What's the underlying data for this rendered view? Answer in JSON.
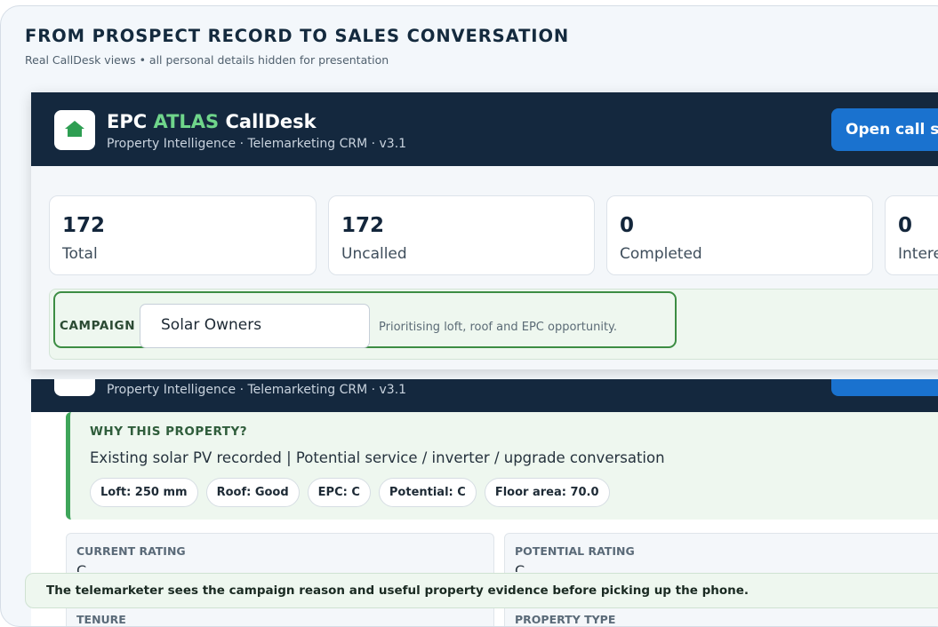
{
  "page": {
    "title": "FROM PROSPECT RECORD TO SALES CONVERSATION",
    "subtitle": "Real CallDesk views • all personal details hidden for presentation",
    "caption": "The telemarketer sees the campaign reason and useful property evidence before picking up the phone."
  },
  "app": {
    "title_prefix": "EPC ",
    "title_accent": "ATLAS",
    "title_suffix": " CallDesk",
    "tagline": "Property Intelligence · Telemarketing CRM · v3.1",
    "open_button": "Open call sh",
    "logo_icon": "house-icon",
    "colors": {
      "header": "#14283e",
      "accent": "#6fd58b",
      "button": "#1a72cf",
      "campaign_ring": "#3c8d43"
    }
  },
  "stats": [
    {
      "value": "172",
      "label": "Total"
    },
    {
      "value": "172",
      "label": "Uncalled"
    },
    {
      "value": "0",
      "label": "Completed"
    },
    {
      "value": "0",
      "label": "Intere"
    }
  ],
  "campaign": {
    "label": "CAMPAIGN",
    "selected": "Solar Owners",
    "note": "Prioritising loft, roof and EPC opportunity."
  },
  "why": {
    "heading": "WHY THIS PROPERTY?",
    "text": "Existing solar PV recorded | Potential service / inverter / upgrade conversation",
    "chips": [
      "Loft: 250 mm",
      "Roof: Good",
      "EPC: C",
      "Potential: C",
      "Floor area: 70.0"
    ]
  },
  "ratings": {
    "current_label": "CURRENT RATING",
    "current_value": "C",
    "potential_label": "POTENTIAL RATING",
    "potential_value": "C",
    "tenure_label": "TENURE",
    "property_type_label": "PROPERTY TYPE"
  }
}
